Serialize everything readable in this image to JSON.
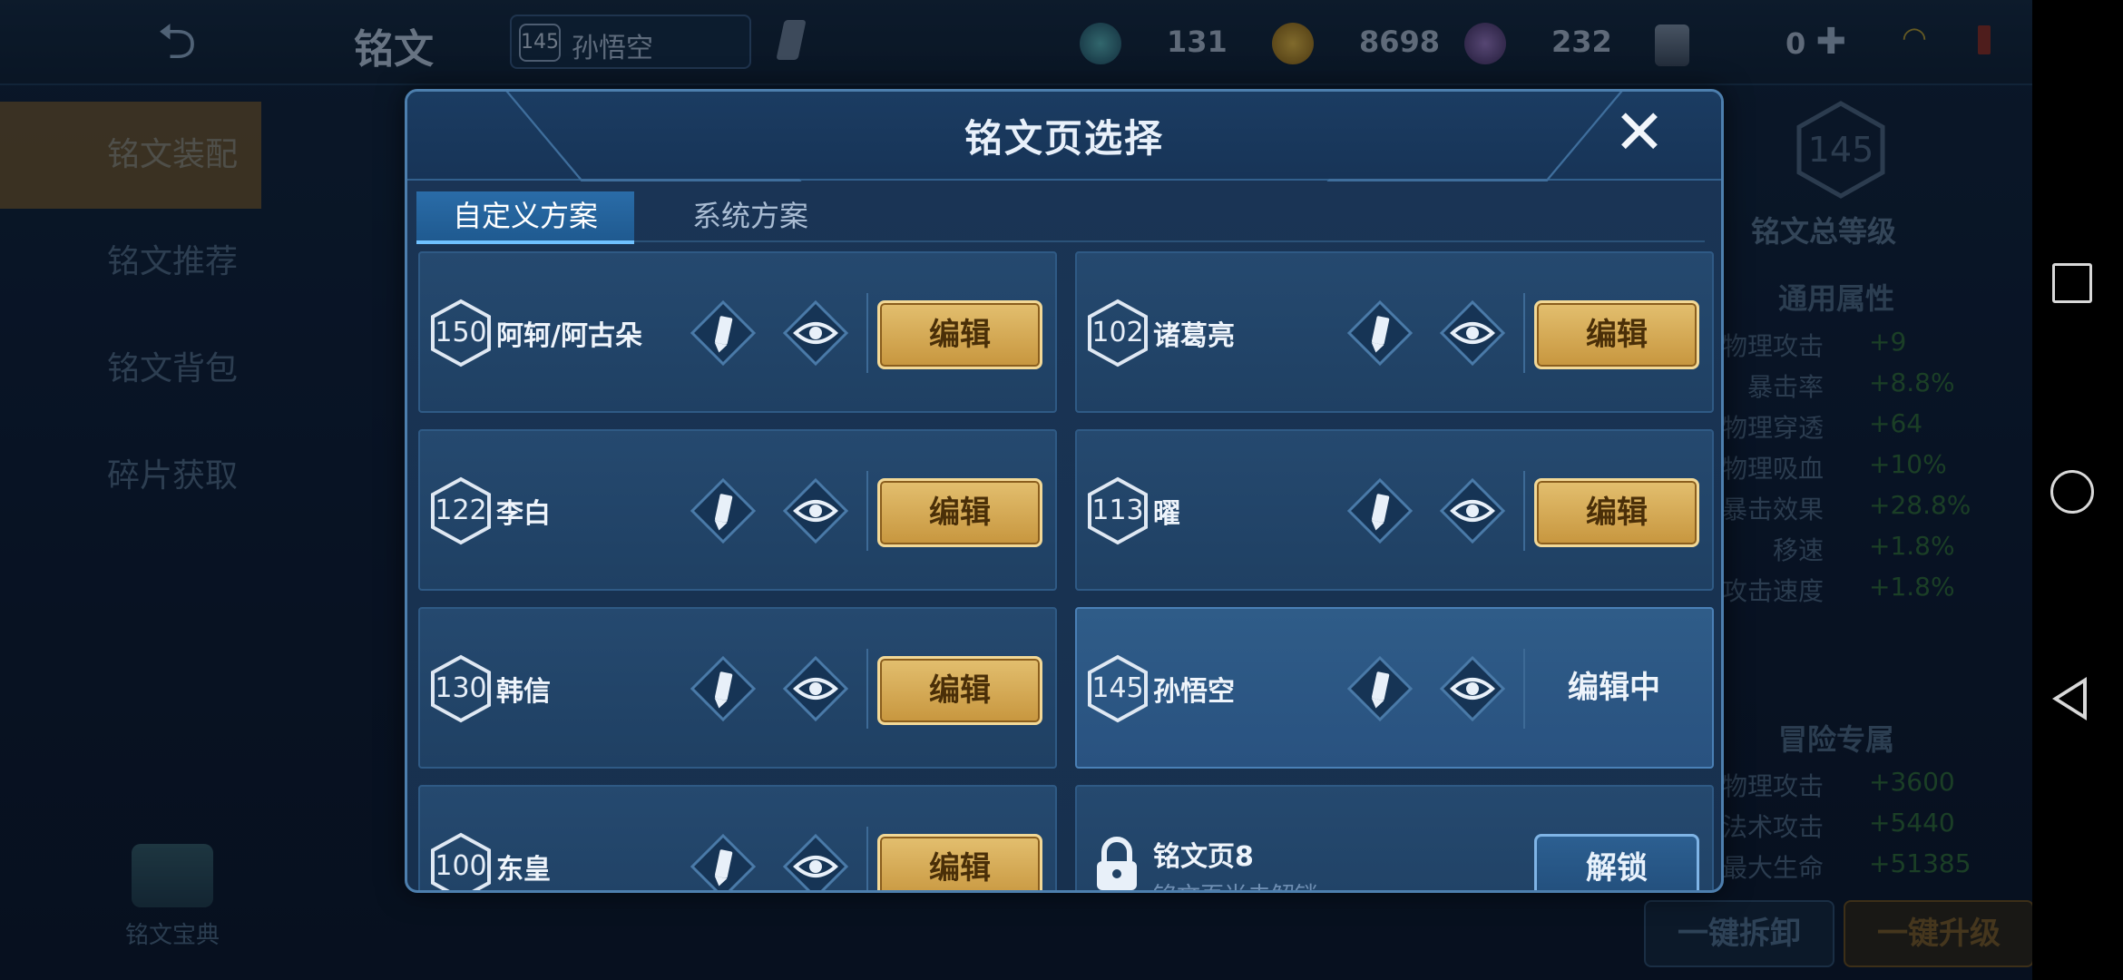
{
  "topbar": {
    "title": "铭文",
    "hero_level": "145",
    "hero_name": "孙悟空",
    "currencies": [
      {
        "icon": "gem-icon",
        "value": "131"
      },
      {
        "icon": "gold-coin-icon",
        "value": "8698"
      },
      {
        "icon": "crystal-icon",
        "value": "232"
      },
      {
        "icon": "card-icon",
        "value": "0"
      }
    ]
  },
  "leftnav": {
    "items": [
      "铭文装配",
      "铭文推荐",
      "铭文背包",
      "碎片获取"
    ],
    "codex_label": "铭文宝典"
  },
  "rightpanel": {
    "total_level": "145",
    "total_label": "铭文总等级",
    "general_title": "通用属性",
    "general": [
      {
        "k": "物理攻击",
        "v": "+9"
      },
      {
        "k": "暴击率",
        "v": "+8.8%"
      },
      {
        "k": "物理穿透",
        "v": "+64"
      },
      {
        "k": "物理吸血",
        "v": "+10%"
      },
      {
        "k": "暴击效果",
        "v": "+28.8%"
      },
      {
        "k": "移速",
        "v": "+1.8%"
      },
      {
        "k": "攻击速度",
        "v": "+1.8%"
      }
    ],
    "adventure_title": "冒险专属",
    "adventure": [
      {
        "k": "物理攻击",
        "v": "+3600"
      },
      {
        "k": "法术攻击",
        "v": "+5440"
      },
      {
        "k": "最大生命",
        "v": "+51385"
      }
    ],
    "dismantle_label": "一键拆卸",
    "upgrade_label": "一键升级"
  },
  "modal": {
    "title": "铭文页选择",
    "tabs": [
      "自定义方案",
      "系统方案"
    ],
    "pages": [
      {
        "level": "150",
        "name": "阿轲/阿古朵",
        "action": "编辑"
      },
      {
        "level": "102",
        "name": "诸葛亮",
        "action": "编辑"
      },
      {
        "level": "122",
        "name": "李白",
        "action": "编辑"
      },
      {
        "level": "113",
        "name": "曜",
        "action": "编辑"
      },
      {
        "level": "130",
        "name": "韩信",
        "action": "编辑"
      },
      {
        "level": "145",
        "name": "孙悟空",
        "action": "编辑中"
      },
      {
        "level": "100",
        "name": "东皇",
        "action": "编辑"
      }
    ],
    "locked_page": {
      "title": "铭文页8",
      "subtitle": "铭文页尚未解锁",
      "action": "解锁"
    }
  }
}
